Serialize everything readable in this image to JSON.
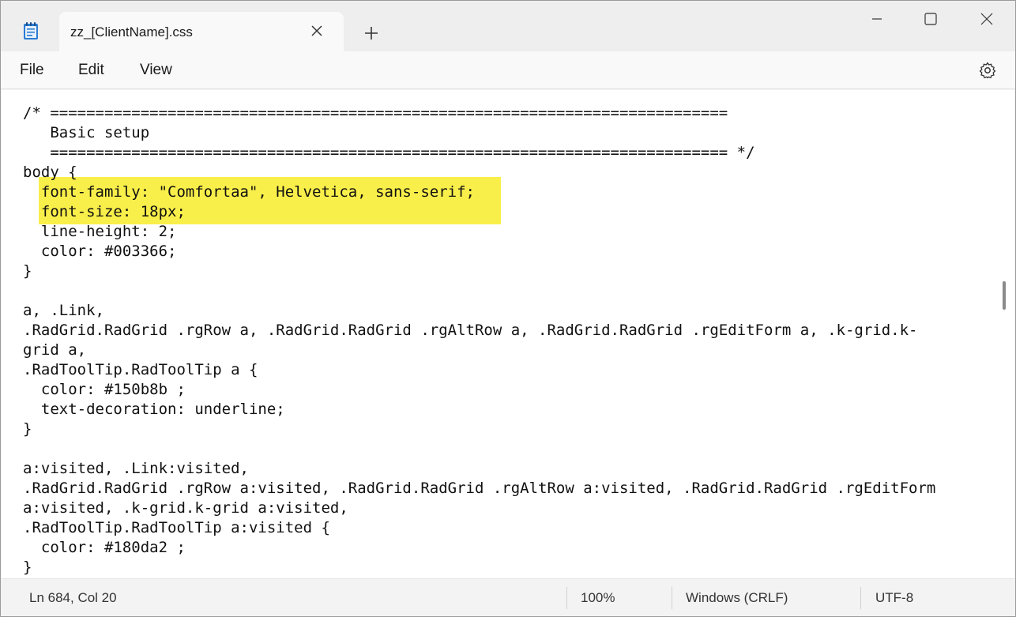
{
  "tab": {
    "title": "zz_[ClientName].css"
  },
  "menu": {
    "file": "File",
    "edit": "Edit",
    "view": "View"
  },
  "code_lines": [
    "/* ===========================================================================",
    "   Basic setup",
    "   =========================================================================== */",
    "body {",
    "  font-family: \"Comfortaa\", Helvetica, sans-serif;",
    "  font-size: 18px;",
    "  line-height: 2;",
    "  color: #003366;",
    "}",
    "",
    "a, .Link,",
    ".RadGrid.RadGrid .rgRow a, .RadGrid.RadGrid .rgAltRow a, .RadGrid.RadGrid .rgEditForm a, .k-grid.k-",
    "grid a,",
    ".RadToolTip.RadToolTip a {",
    "  color: #150b8b ;",
    "  text-decoration: underline;",
    "}",
    "",
    "a:visited, .Link:visited,",
    ".RadGrid.RadGrid .rgRow a:visited, .RadGrid.RadGrid .rgAltRow a:visited, .RadGrid.RadGrid .rgEditForm",
    "a:visited, .k-grid.k-grid a:visited,",
    ".RadToolTip.RadToolTip a:visited {",
    "  color: #180da2 ;",
    "}"
  ],
  "highlighted_lines": [
    4,
    5
  ],
  "highlight_color": "#f9ef4a",
  "status": {
    "position": "Ln 684, Col 20",
    "zoom": "100%",
    "line_ending": "Windows (CRLF)",
    "encoding": "UTF-8"
  },
  "icons": {
    "app": "notepad-icon",
    "close_tab": "close-icon",
    "new_tab": "plus-icon",
    "minimize": "minimize-icon",
    "maximize": "maximize-icon",
    "close_window": "close-icon",
    "settings": "gear-icon"
  }
}
